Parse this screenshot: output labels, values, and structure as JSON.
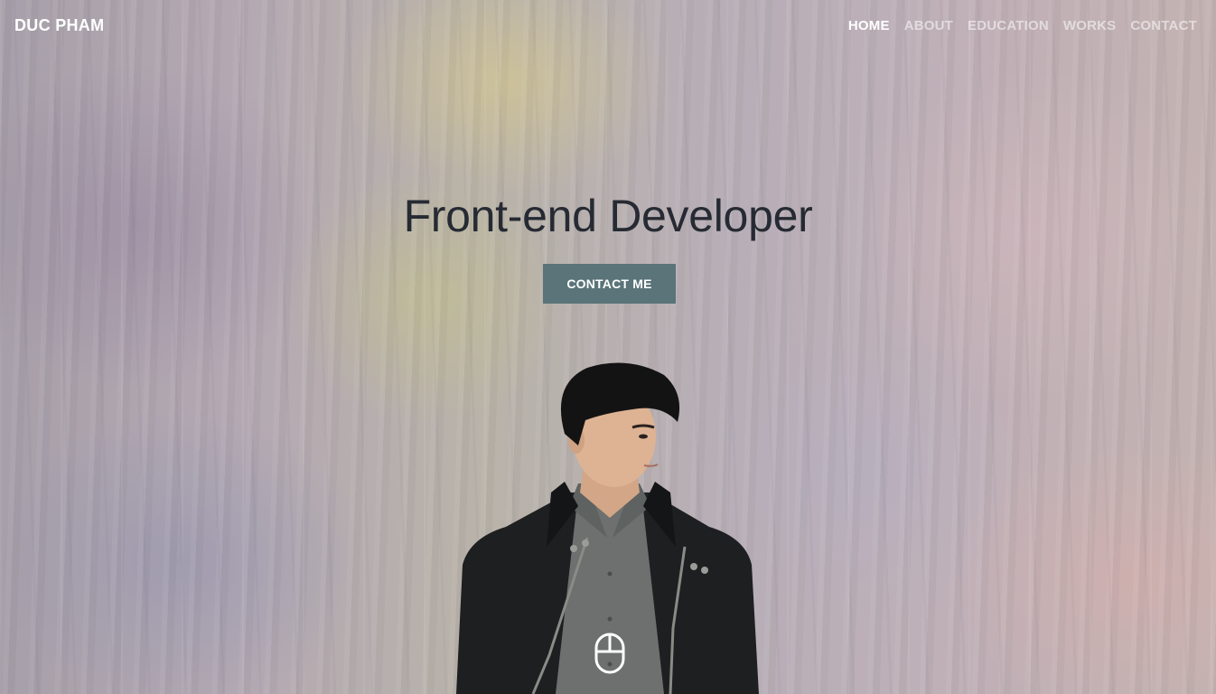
{
  "brand": {
    "name": "DUC PHAM"
  },
  "nav": {
    "items": [
      {
        "label": "HOME",
        "active": true
      },
      {
        "label": "ABOUT",
        "active": false
      },
      {
        "label": "EDUCATION",
        "active": false
      },
      {
        "label": "WORKS",
        "active": false
      },
      {
        "label": "CONTACT",
        "active": false
      }
    ]
  },
  "hero": {
    "headline": "Front-end Developer",
    "cta_label": "CONTACT ME",
    "scroll_icon": "mouse-icon"
  },
  "colors": {
    "cta_background": "#5a7479",
    "headline_text": "#262a33",
    "nav_active": "#ffffff",
    "jacket": "#1e1f21",
    "shirt": "#6d706f"
  }
}
